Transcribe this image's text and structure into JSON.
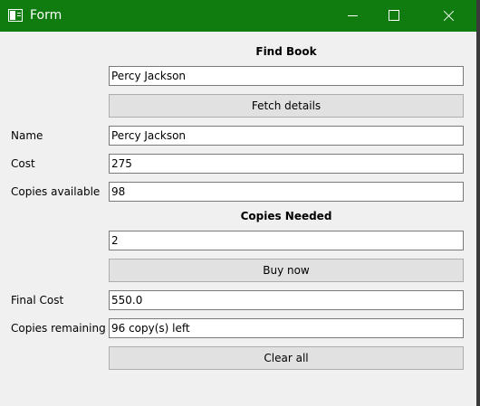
{
  "window": {
    "title": "Form",
    "app_icon": "window-app-icon",
    "minimize_icon": "minimize-icon",
    "maximize_icon": "maximize-icon",
    "close_icon": "close-icon",
    "titlebar_color": "#107c10"
  },
  "find_book": {
    "heading": "Find Book",
    "query_value": "Percy Jackson",
    "fetch_label": "Fetch details"
  },
  "details": {
    "name_label": "Name",
    "name_value": "Percy Jackson",
    "cost_label": "Cost",
    "cost_value": "275",
    "copies_label": "Copies available",
    "copies_value": "98"
  },
  "purchase": {
    "heading": "Copies Needed",
    "needed_value": "2",
    "buy_label": "Buy now"
  },
  "result": {
    "final_cost_label": "Final Cost",
    "final_cost_value": "550.0",
    "remaining_label": "Copies remaining",
    "remaining_value": "96 copy(s) left",
    "clear_label": "Clear all"
  }
}
